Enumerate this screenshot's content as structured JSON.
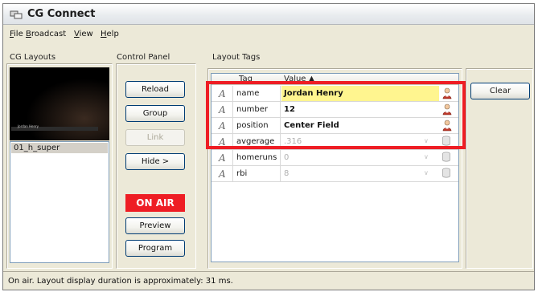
{
  "window": {
    "title": "CG Connect"
  },
  "menu": {
    "file": "ile",
    "file_u": "F",
    "broadcast": "roadcast",
    "broadcast_u": "B",
    "view": "iew",
    "view_u": "V",
    "help": "elp",
    "help_u": "H"
  },
  "panels": {
    "layouts": "CG Layouts",
    "control": "Control Panel",
    "tags": "Layout Tags"
  },
  "layouts": {
    "items": [
      "01_h_super"
    ],
    "thumbnail_text": "Jordan Henry"
  },
  "control": {
    "reload": "Reload",
    "group": "Group",
    "link": "Link",
    "hide": "Hide >",
    "on_air": "ON AIR",
    "preview": "Preview",
    "program": "Program"
  },
  "grid": {
    "col_tag": "Tag",
    "col_value": "Value",
    "rows": [
      {
        "tag": "name",
        "value": "Jordan Henry",
        "icon": "person-icon"
      },
      {
        "tag": "number",
        "value": "12",
        "icon": "person-icon"
      },
      {
        "tag": "position",
        "value": "Center Field",
        "icon": "person-icon"
      },
      {
        "tag": "avgerage",
        "value": ".316",
        "icon": "barrel-icon"
      },
      {
        "tag": "homeruns",
        "value": "0",
        "icon": "barrel-icon"
      },
      {
        "tag": "rbi",
        "value": "8",
        "icon": "barrel-icon"
      }
    ]
  },
  "clear": "Clear",
  "status": "On air. Layout display duration is approximately: 31 ms.",
  "colors": {
    "on_air": "#ee1d24",
    "highlight": "#ee1d24",
    "selected_row": "#fff58f"
  }
}
